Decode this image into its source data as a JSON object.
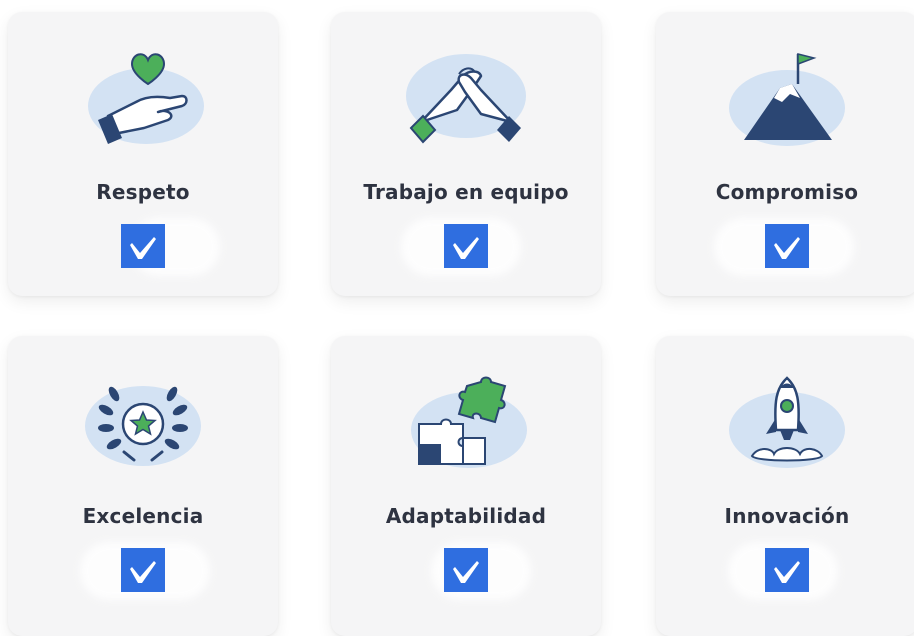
{
  "values": [
    {
      "label": "Respeto",
      "icon": "heart-hand-icon",
      "checked": true
    },
    {
      "label": "Trabajo en equipo",
      "icon": "handshake-icon",
      "checked": true
    },
    {
      "label": "Compromiso",
      "icon": "mountain-flag-icon",
      "checked": true
    },
    {
      "label": "Excelencia",
      "icon": "laurel-star-icon",
      "checked": true
    },
    {
      "label": "Adaptabilidad",
      "icon": "puzzle-icon",
      "checked": true
    },
    {
      "label": "Innovación",
      "icon": "rocket-icon",
      "checked": true
    }
  ],
  "colors": {
    "accent_blue": "#2f6ee0",
    "navy": "#2b4673",
    "green": "#4caf5a",
    "blob": "#d3e2f3",
    "card_bg": "#f5f5f6",
    "label_text": "#2e3341"
  }
}
